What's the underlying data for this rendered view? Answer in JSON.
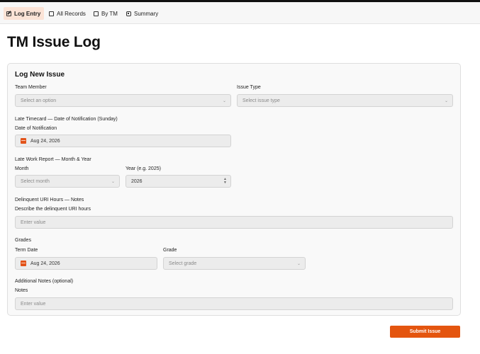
{
  "nav": {
    "tabs": [
      {
        "label": "Log Entry",
        "icon": "edit-icon"
      },
      {
        "label": "All Records",
        "icon": "checkbox-icon"
      },
      {
        "label": "By TM",
        "icon": "checkbox-icon"
      },
      {
        "label": "Summary",
        "icon": "summary-icon"
      }
    ]
  },
  "page": {
    "title": "TM Issue Log"
  },
  "form": {
    "title": "Log New Issue",
    "team_member": {
      "label": "Team Member",
      "placeholder": "Select an option"
    },
    "issue_type": {
      "label": "Issue Type",
      "placeholder": "Select issue type"
    },
    "late_timecard": {
      "section": "Late Timecard — Date of Notification (Sunday)",
      "label": "Date of Notification",
      "value": "Aug 24, 2026"
    },
    "late_work_report": {
      "section": "Late Work Report — Month & Year",
      "month_label": "Month",
      "month_placeholder": "Select month",
      "year_label": "Year (e.g. 2025)",
      "year_value": "2026"
    },
    "delinquent": {
      "section": "Delinquent URI Hours — Notes",
      "label": "Describe the delinquent URI hours",
      "placeholder": "Enter value"
    },
    "grades": {
      "section": "Grades",
      "term_label": "Term Date",
      "term_value": "Aug 24, 2026",
      "grade_label": "Grade",
      "grade_placeholder": "Select grade"
    },
    "notes": {
      "section": "Additional Notes (optional)",
      "label": "Notes",
      "placeholder": "Enter value"
    }
  },
  "actions": {
    "submit_label": "Submit Issue"
  },
  "colors": {
    "accent": "#e4550f",
    "active_tab_bg": "#fbe3d6"
  }
}
